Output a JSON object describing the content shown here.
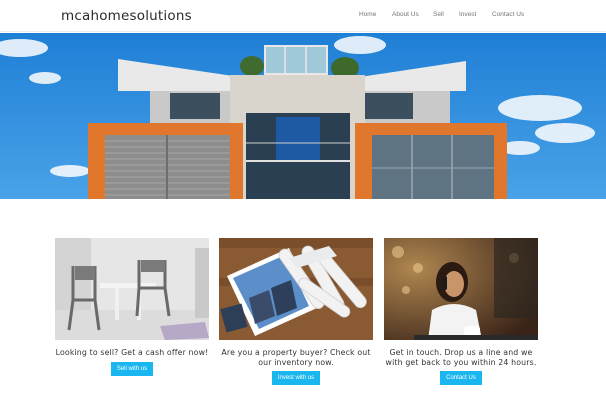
{
  "header": {
    "logo": "mcahomesolutions",
    "nav": [
      "Home",
      "About Us",
      "Sell",
      "Invest",
      "Contact Us"
    ]
  },
  "colors": {
    "accent": "#1ab6f0",
    "sky": "#2f8fdc",
    "facade_orange": "#e0772d"
  },
  "cards": [
    {
      "caption": "Looking to sell? Get a cash offer now!",
      "button": "Sell with us"
    },
    {
      "caption": "Are you a property buyer? Check out our inventory now.",
      "button": "Invest with us"
    },
    {
      "caption": "Get in touch. Drop us a line and we with get back to you within 24 hours.",
      "button": "Contact Us"
    }
  ]
}
